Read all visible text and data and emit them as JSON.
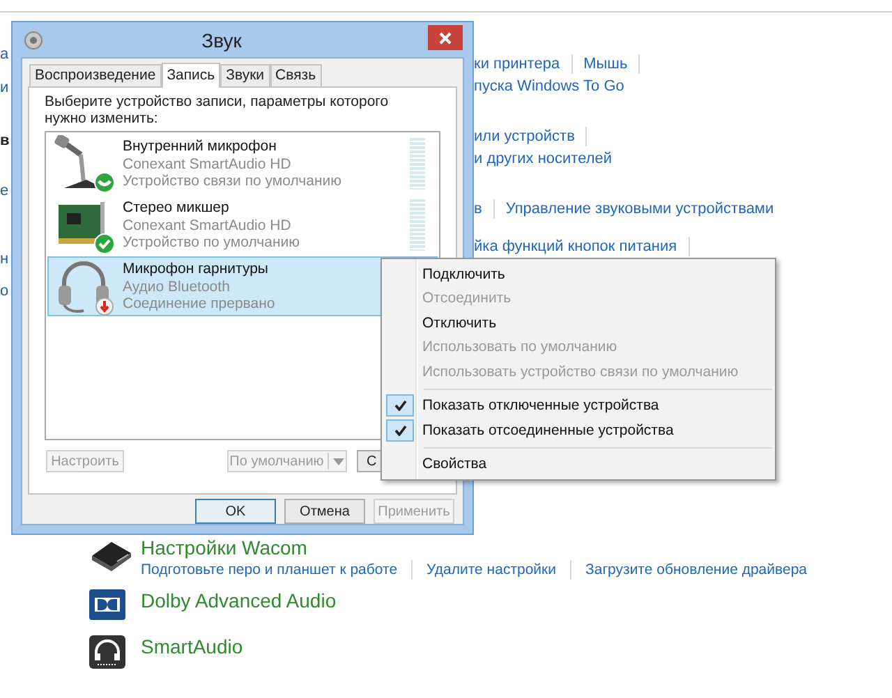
{
  "background": {
    "left_fragments": [
      "а",
      "и",
      "в",
      "е",
      "н",
      "о"
    ],
    "link_rows": [
      {
        "links": [
          "ки принтера",
          "Мышь"
        ],
        "trail_separator": true
      },
      {
        "links": [
          "пуска Windows To Go"
        ],
        "trail_separator": false
      },
      {
        "links": [
          "или устройств"
        ],
        "trail_separator": true
      },
      {
        "links": [
          "и других носителей"
        ],
        "trail_separator": false
      },
      {
        "links": [
          "в",
          "Управление звуковыми устройствами"
        ],
        "trail_separator": false
      },
      {
        "links": [
          "йка функций кнопок питания"
        ],
        "trail_separator": true
      }
    ],
    "apps": [
      {
        "kind": "tablet",
        "title": "Настройки Wacom",
        "links": [
          "Подготовьте перо и планшет к работе",
          "Удалите настройки",
          "Загрузите обновление драйвера"
        ]
      },
      {
        "kind": "dolby",
        "title": "Dolby Advanced Audio"
      },
      {
        "kind": "headphones",
        "title": "SmartAudio"
      }
    ]
  },
  "dialog": {
    "title": "Звук",
    "tabs": [
      {
        "label": "Воспроизведение",
        "selected": false
      },
      {
        "label": "Запись",
        "selected": true
      },
      {
        "label": "Звуки",
        "selected": false
      },
      {
        "label": "Связь",
        "selected": false
      }
    ],
    "instruction": "Выберите устройство записи, параметры которого нужно изменить:",
    "devices": [
      {
        "kind": "microphone",
        "name": "Внутренний микрофон",
        "driver": "Conexant SmartAudio HD",
        "status": "Устройство связи по умолчанию",
        "selected": false,
        "level": 0
      },
      {
        "kind": "card",
        "name": "Стерео микшер",
        "driver": "Conexant SmartAudio HD",
        "status": "Устройство по умолчанию",
        "selected": false,
        "level": 0
      },
      {
        "kind": "headset",
        "name": "Микрофон гарнитуры",
        "driver": "Аудио Bluetooth",
        "status": "Соединение прервано",
        "selected": true
      }
    ],
    "list_buttons": [
      {
        "label": "Настроить",
        "disabled": true,
        "kind": "plain"
      },
      {
        "label": "По умолчанию",
        "disabled": true,
        "kind": "split"
      },
      {
        "label": "С",
        "disabled": false,
        "kind": "plain"
      }
    ],
    "footer_buttons": [
      {
        "label": "OK",
        "disabled": false,
        "default": true
      },
      {
        "label": "Отмена",
        "disabled": false,
        "default": false
      },
      {
        "label": "Применить",
        "disabled": true,
        "default": false
      }
    ]
  },
  "context_menu": {
    "items": [
      {
        "kind": "item",
        "label": "Подключить",
        "disabled": false,
        "checked": false
      },
      {
        "kind": "item",
        "label": "Отсоединить",
        "disabled": true,
        "checked": false
      },
      {
        "kind": "item",
        "label": "Отключить",
        "disabled": false,
        "checked": false
      },
      {
        "kind": "item",
        "label": "Использовать по умолчанию",
        "disabled": true,
        "checked": false
      },
      {
        "kind": "item",
        "label": "Использовать устройство связи по умолчанию",
        "disabled": true,
        "checked": false
      },
      {
        "kind": "separator"
      },
      {
        "kind": "item",
        "label": "Показать отключенные устройства",
        "disabled": false,
        "checked": true
      },
      {
        "kind": "item",
        "label": "Показать отсоединенные устройства",
        "disabled": false,
        "checked": true
      },
      {
        "kind": "separator"
      },
      {
        "kind": "item",
        "label": "Свойства",
        "disabled": false,
        "checked": false
      }
    ]
  }
}
